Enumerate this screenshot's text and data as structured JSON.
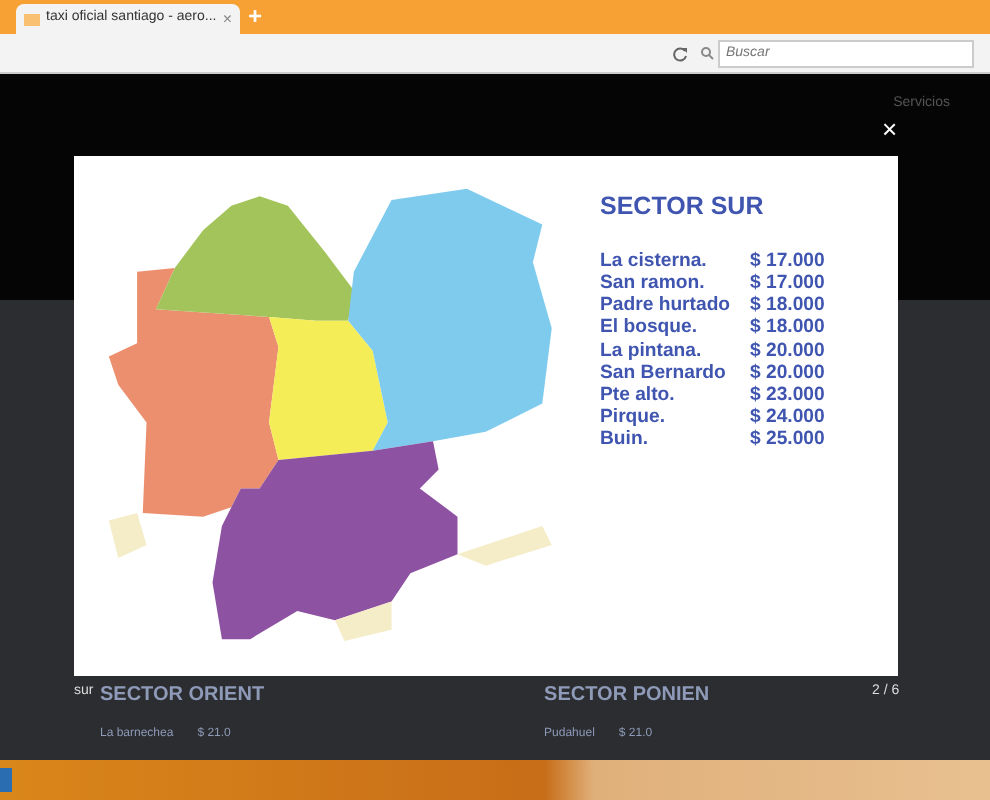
{
  "browser": {
    "tab_title": "taxi oficial santiago - aero...",
    "tab_close": "×",
    "new_tab": "+",
    "search": {
      "placeholder": "Buscar"
    }
  },
  "page": {
    "nav": [
      "Servicios"
    ],
    "sections": [
      {
        "title": "SECTOR ORIENT",
        "row": [
          "La barnechea",
          "$ 21.0"
        ]
      },
      {
        "title": "SECTOR PONIEN",
        "row": [
          "Pudahuel",
          "$ 21.0"
        ]
      }
    ]
  },
  "lightbox": {
    "close": "×",
    "caption": "sur",
    "counter": "2 / 6",
    "title": "SECTOR SUR",
    "prices": [
      {
        "place": "La cisterna.",
        "price": "$ 17.000"
      },
      {
        "place": "San ramon.",
        "price": "$ 17.000"
      },
      {
        "place": "Padre hurtado",
        "price": "$ 18.000"
      },
      {
        "place": "El bosque.",
        "price": "$ 18.000"
      },
      {
        "place": "La pintana.",
        "price": "$ 20.000"
      },
      {
        "place": "San Bernardo",
        "price": "$ 20.000"
      },
      {
        "place": "Pte alto.",
        "price": "$ 23.000"
      },
      {
        "place": "Pirque.",
        "price": "$ 24.000"
      },
      {
        "place": "Buin.",
        "price": "$ 25.000"
      }
    ]
  }
}
